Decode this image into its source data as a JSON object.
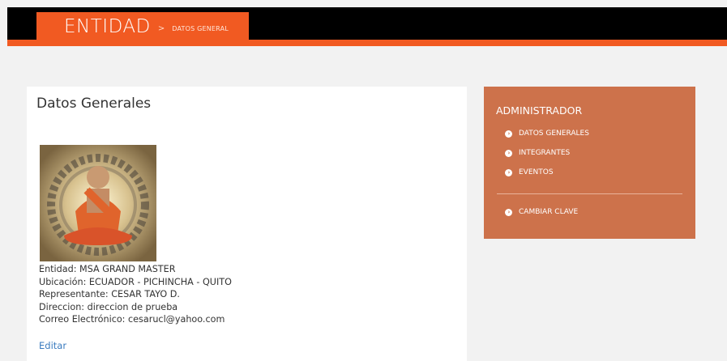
{
  "header": {
    "section": "ENTIDAD",
    "separator": ">",
    "subsection": "DATOS GENERAL"
  },
  "main": {
    "title": "Datos Generales",
    "entity": "Entidad: MSA GRAND MASTER",
    "location": "Ubicación: ECUADOR - PICHINCHA - QUITO",
    "representative": "Representante: CESAR TAYO D.",
    "address": "Direccion: direccion de prueba",
    "email": "Correo Electrónico: cesarucl@yahoo.com",
    "edit_label": "Editar"
  },
  "sidebar": {
    "title": "ADMINISTRADOR",
    "items": [
      {
        "label": "DATOS GENERALES",
        "icon": "arrow-circle-right-icon"
      },
      {
        "label": "INTEGRANTES",
        "icon": "arrow-circle-right-icon"
      },
      {
        "label": "EVENTOS",
        "icon": "arrow-circle-right-icon"
      }
    ],
    "footer_item": {
      "label": "CAMBIAR CLAVE",
      "icon": "arrow-circle-right-icon"
    }
  },
  "colors": {
    "accent": "#f15a22",
    "panel": "#cd724b",
    "link": "#3a7bbf"
  }
}
